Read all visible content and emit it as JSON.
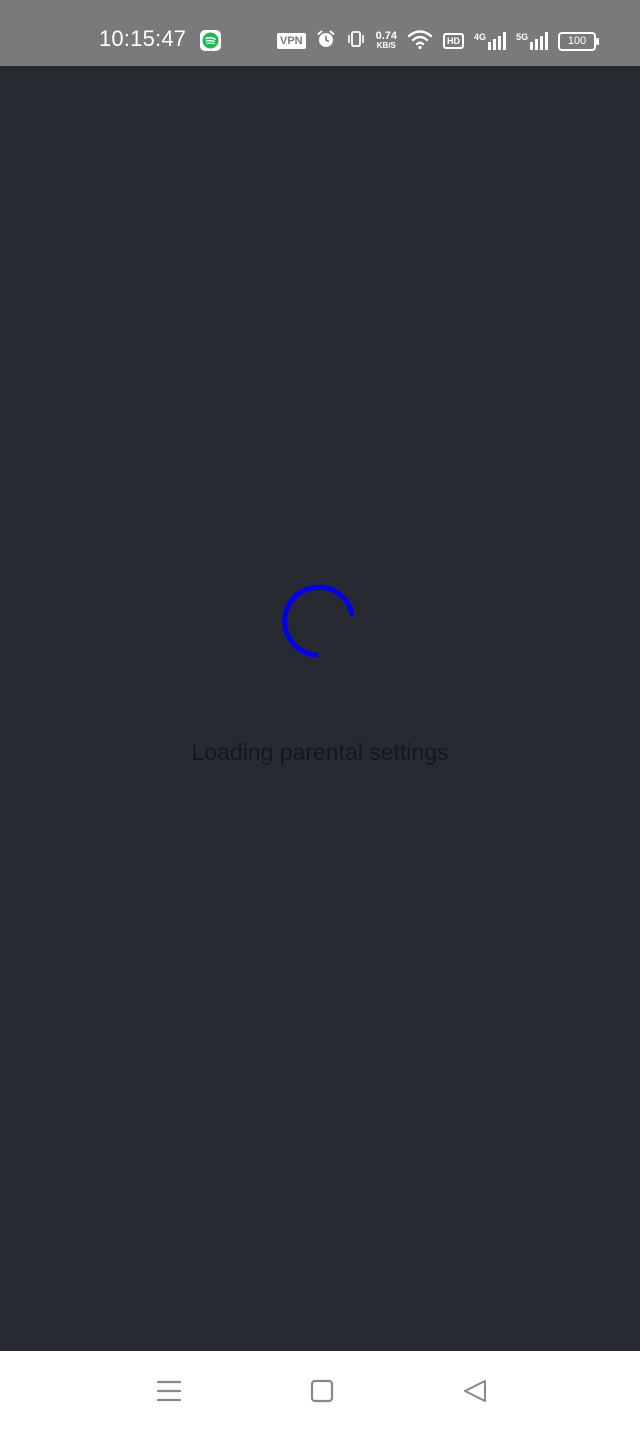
{
  "status_bar": {
    "time": "10:15:47",
    "vpn_label": "VPN",
    "network_speed_value": "0.74",
    "network_speed_unit": "KB/S",
    "hd_label": "HD",
    "signal_1_label": "4G",
    "signal_2_label": "5G",
    "battery_level": "100",
    "icons": [
      "spotify-icon",
      "alarm-icon",
      "vibrate-icon",
      "wifi-icon",
      "signal-icon",
      "battery-icon"
    ]
  },
  "main": {
    "loading_text": "Loading parental settings",
    "spinner_color": "#0000ee",
    "background_color": "#282a31"
  },
  "nav_bar": {
    "buttons": [
      "menu-button",
      "home-button",
      "back-button"
    ]
  }
}
